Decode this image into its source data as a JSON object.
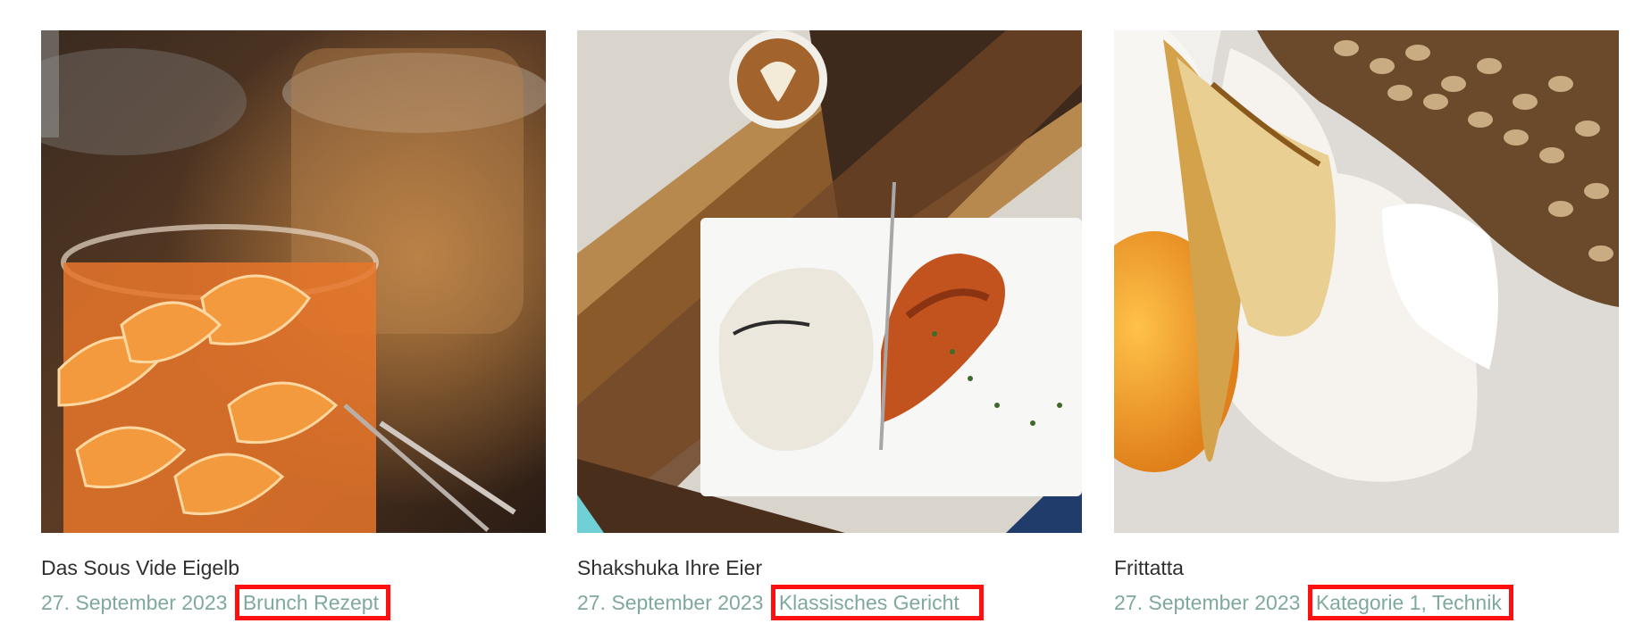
{
  "posts": [
    {
      "title": "Das Sous Vide Eigelb",
      "date": "27. September 2023",
      "categories": [
        "Brunch Rezept"
      ],
      "image": "glass jars with dried orange slices"
    },
    {
      "title": "Shakshuka Ihre Eier",
      "date": "27. September 2023",
      "categories": [
        "Klassisches Gericht"
      ],
      "image": "plate with wrap and red sauce on wooden board, latte cup"
    },
    {
      "title": "Frittatta",
      "date": "27. September 2023",
      "categories": [
        "Kategorie 1",
        "Technik"
      ],
      "image": "fried egg with seeded bread"
    }
  ],
  "colors": {
    "meta_text": "#7fa99e",
    "title_text": "#2f2f2f",
    "highlight_box": "#ff1010"
  }
}
